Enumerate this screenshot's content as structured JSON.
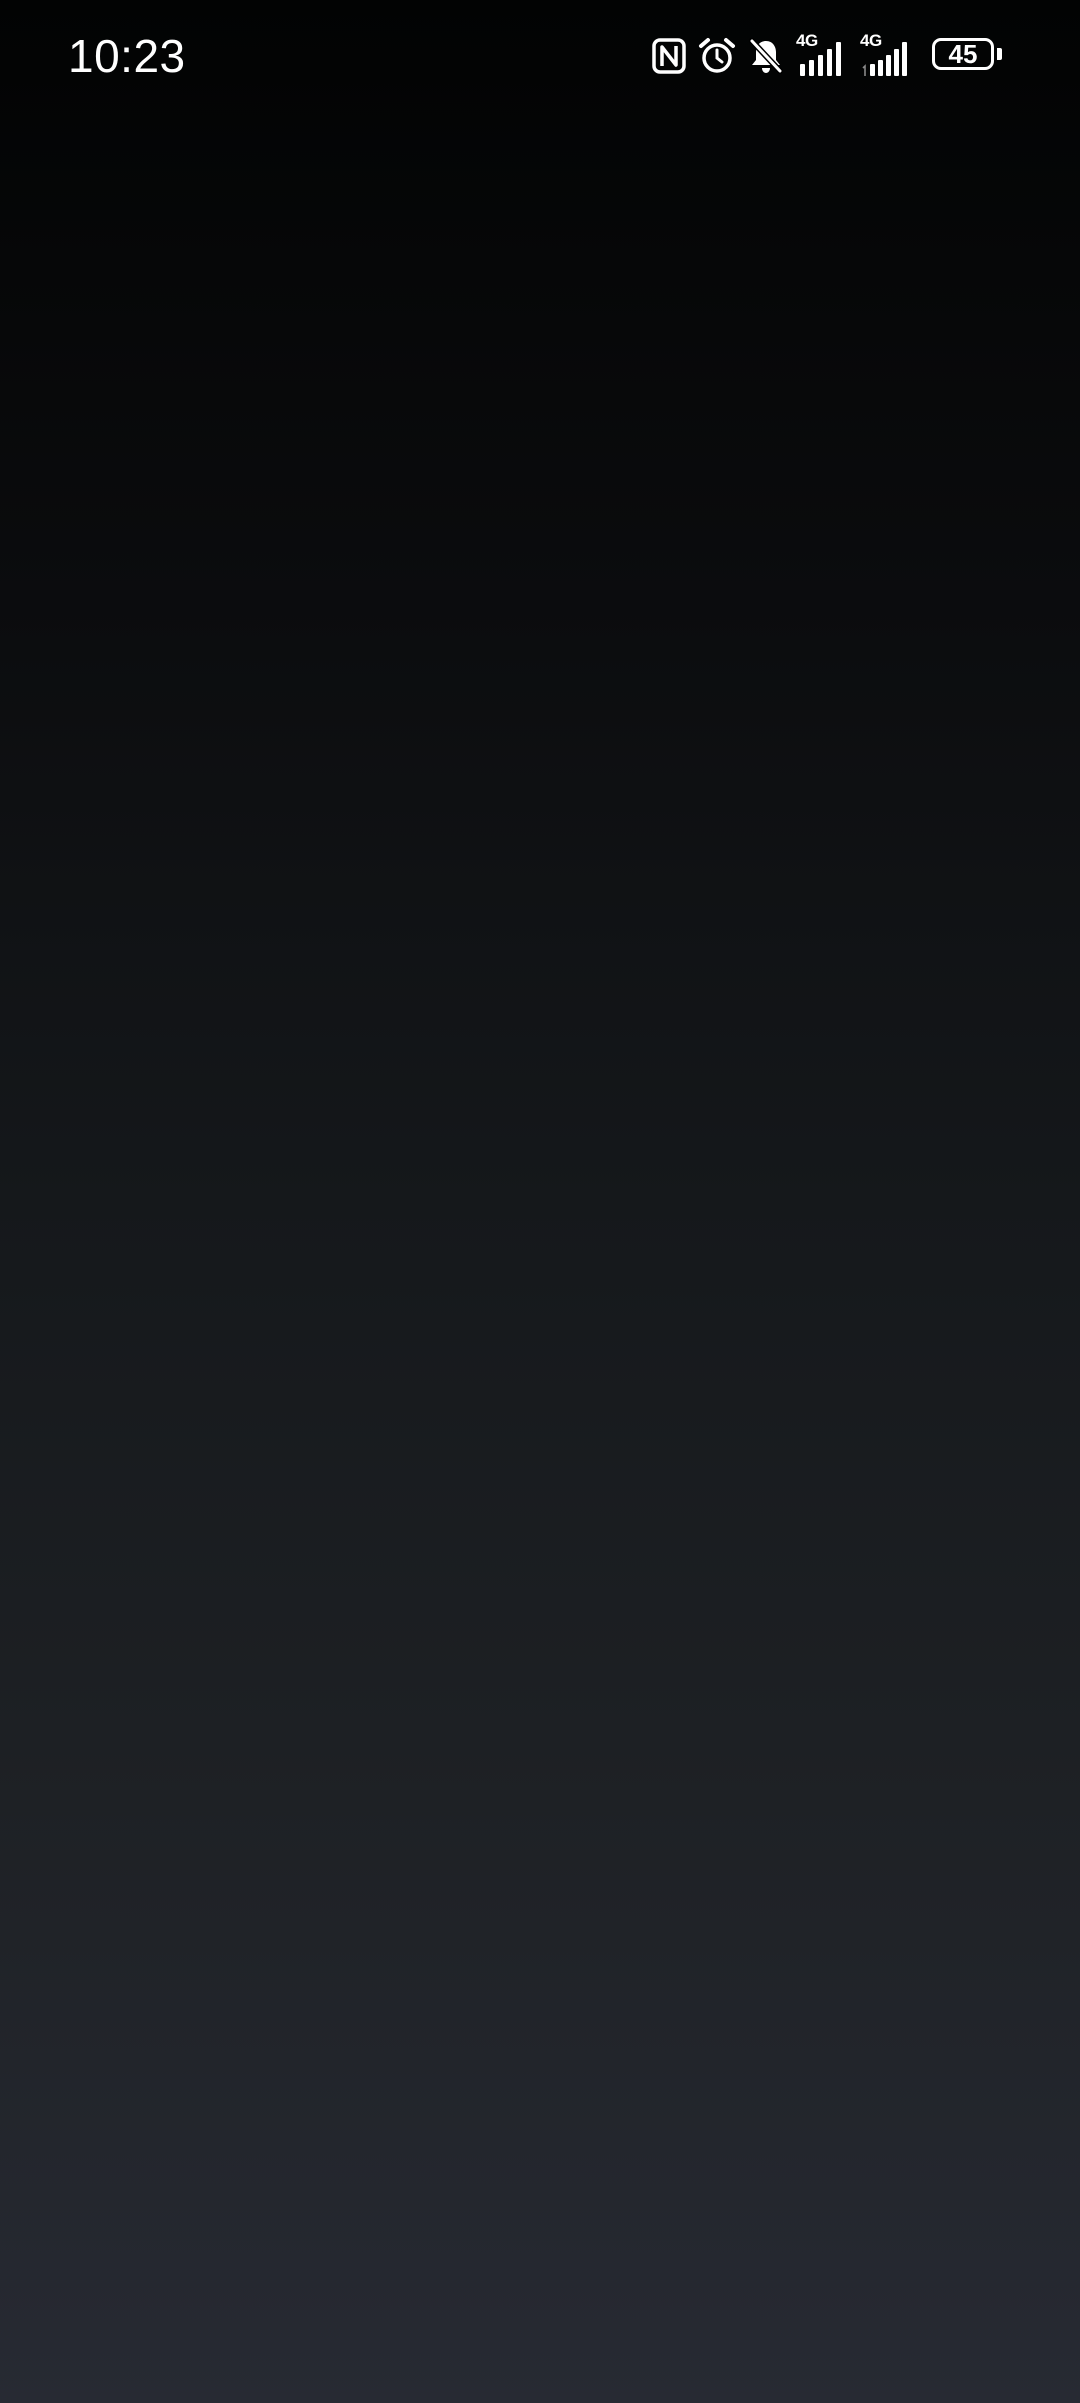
{
  "status_bar": {
    "time": "10:23",
    "icons": [
      "nfc-icon",
      "alarm-icon",
      "notifications-muted-icon",
      "signal-4g-sim1-icon",
      "signal-4g-sim2-icon",
      "battery-icon"
    ],
    "sim1": {
      "network": "4G",
      "signal_bars": 5
    },
    "sim2": {
      "network": "4G",
      "signal_bars": 5
    },
    "battery": {
      "level": "45"
    }
  },
  "background": {
    "gradient_top": "#020303",
    "gradient_bottom": "#272a33"
  }
}
